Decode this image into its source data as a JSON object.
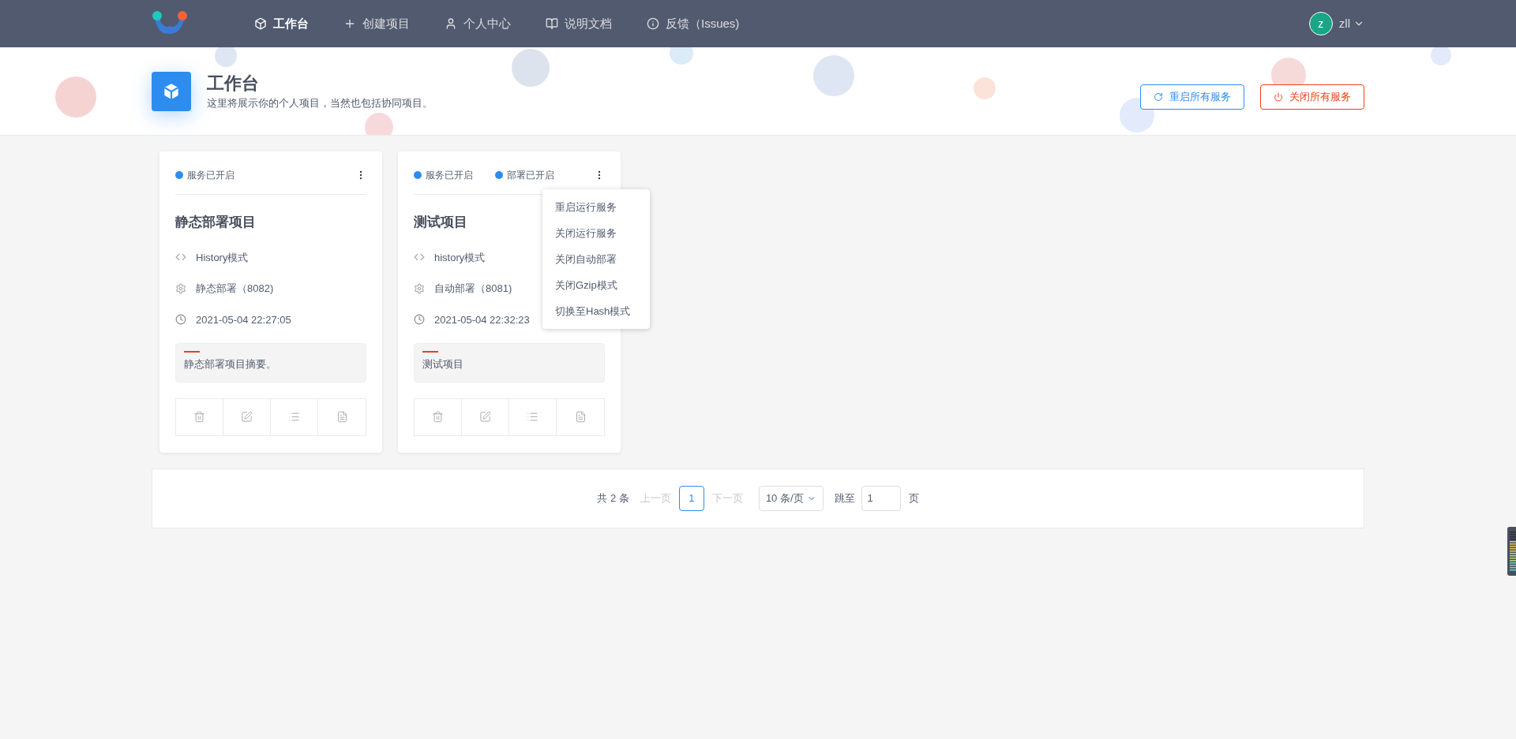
{
  "nav": {
    "items": [
      {
        "kind": "cube",
        "label": "工作台",
        "selected": true
      },
      {
        "kind": "plus",
        "label": "创建项目",
        "selected": false
      },
      {
        "kind": "user",
        "label": "个人中心",
        "selected": false
      },
      {
        "kind": "book",
        "label": "说明文档",
        "selected": false
      },
      {
        "kind": "info",
        "label": "反馈（Issues)",
        "selected": false
      }
    ],
    "user": {
      "avatar": "z",
      "name": "zll"
    }
  },
  "header": {
    "title": "工作台",
    "subtitle": "这里将展示你的个人项目，当然也包括协同项目。",
    "buttons": [
      {
        "kind": "restart",
        "label": "重启所有服务"
      },
      {
        "kind": "stop",
        "label": "关闭所有服务"
      }
    ]
  },
  "cards": [
    {
      "tags": [
        {
          "label": "服务已开启",
          "color": "#2d8cf0"
        }
      ],
      "title": "静态部署项目",
      "mode": "History模式",
      "deploy": "静态部署（8082)",
      "time": "2021-05-04 22:27:05",
      "summary": "静态部署项目摘要。",
      "menu_open": false
    },
    {
      "tags": [
        {
          "label": "服务已开启",
          "color": "#2d8cf0"
        },
        {
          "label": "部署已开启",
          "color": "#2d8cf0"
        }
      ],
      "title": "测试项目",
      "mode": "history模式",
      "deploy": "自动部署（8081)",
      "time": "2021-05-04 22:32:23",
      "summary": "测试项目",
      "menu_open": true
    }
  ],
  "menu": {
    "items": [
      "重启运行服务",
      "关闭运行服务",
      "关闭自动部署",
      "关闭Gzip模式",
      "切换至Hash模式"
    ]
  },
  "pagination": {
    "total": "共 2 条",
    "prev": {
      "label": "上一页",
      "disabled": true
    },
    "pages": [
      {
        "label": "1",
        "selected": true
      }
    ],
    "next": {
      "label": "下一页",
      "disabled": true
    },
    "page_size": "10 条/页",
    "jump_label": "跳至",
    "jump_value": "1",
    "page_suffix": "页"
  }
}
